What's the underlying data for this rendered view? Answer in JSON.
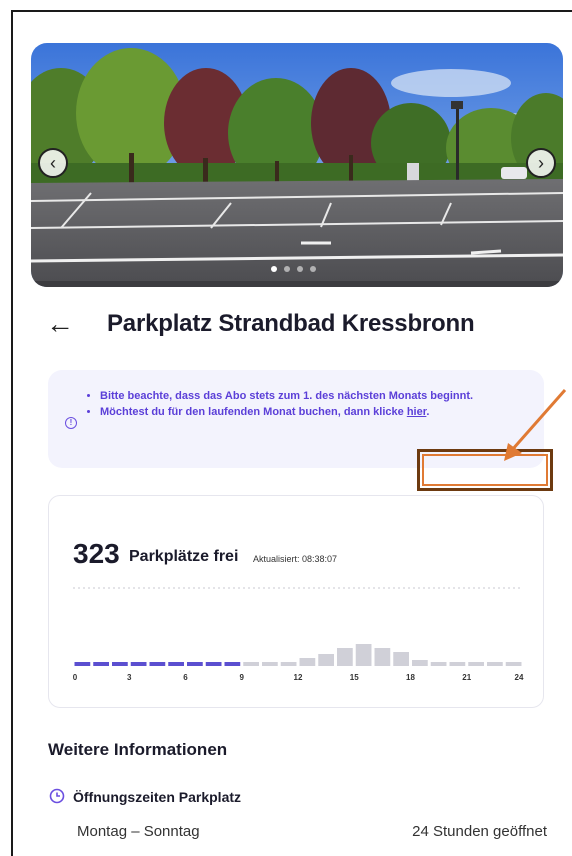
{
  "header": {
    "title": "Parkplatz Strandbad Kressbronn"
  },
  "carousel": {
    "dot_count": 4,
    "active_index": 0
  },
  "notice": {
    "line1": "Bitte beachte, dass das Abo stets zum 1. des nächsten Monats beginnt.",
    "line2_prefix": "Möchtest du für den laufenden Monat buchen, dann klicke ",
    "line2_link": "hier",
    "line2_suffix": "."
  },
  "occupancy": {
    "count": "323",
    "label": "Parkplätze frei",
    "updated": "Aktualisiert: 08:38:07"
  },
  "chart_data": {
    "type": "bar",
    "x_ticks": [
      "0",
      "3",
      "6",
      "9",
      "12",
      "15",
      "18",
      "21",
      "24"
    ],
    "hours": [
      0,
      1,
      2,
      3,
      4,
      5,
      6,
      7,
      8,
      9,
      10,
      11,
      12,
      13,
      14,
      15,
      16,
      17,
      18,
      19,
      20,
      21,
      22,
      23
    ],
    "values": [
      0.1,
      0.1,
      0.1,
      0.1,
      0.1,
      0.1,
      0.1,
      0.1,
      0.1,
      0.1,
      0.1,
      0.1,
      0.2,
      0.3,
      0.45,
      0.55,
      0.45,
      0.35,
      0.15,
      0.1,
      0.1,
      0.1,
      0.1,
      0.1
    ],
    "current_hours": [
      0,
      1,
      2,
      3,
      4,
      5,
      6,
      7,
      8
    ],
    "colors": {
      "current": "#5b4fd0",
      "other": "#d0d0d8"
    }
  },
  "info": {
    "heading": "Weitere Informationen",
    "hours_heading": "Öffnungszeiten Parkplatz",
    "day_range": "Montag – Sonntag",
    "hours_value": "24 Stunden geöffnet"
  },
  "icons": {
    "back": "arrow-left-icon",
    "prev": "chevron-left-icon",
    "next": "chevron-right-icon",
    "info": "info-circle-icon",
    "clock": "clock-icon"
  }
}
